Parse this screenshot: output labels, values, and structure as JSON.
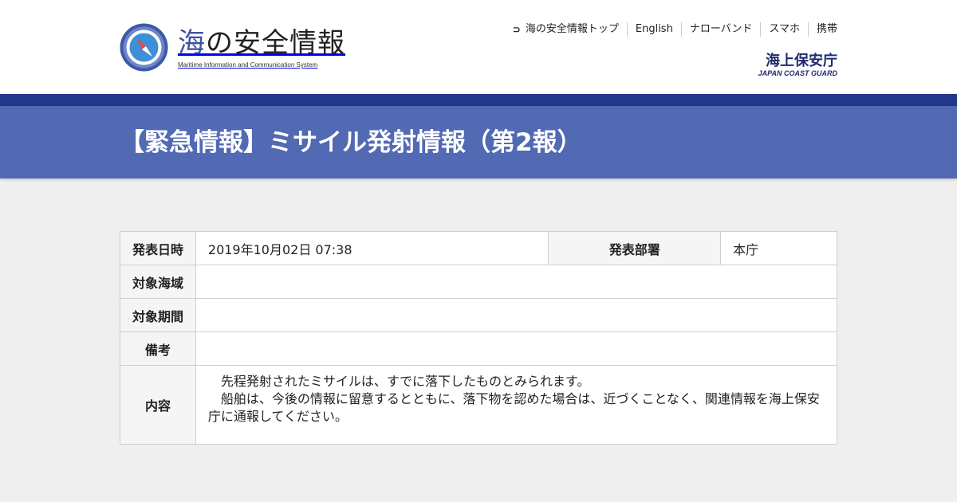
{
  "site": {
    "title_accent": "海",
    "title_rest": "の安全情報",
    "subtitle": "Maritime Information and Communication System",
    "logo_icon": "compass-icon"
  },
  "topnav": {
    "items": [
      {
        "label": "海の安全情報トップ",
        "icon": "return-arrow-icon"
      },
      {
        "label": "English"
      },
      {
        "label": "ナローバンド"
      },
      {
        "label": "スマホ"
      },
      {
        "label": "携帯"
      }
    ]
  },
  "agency": {
    "name_jp": "海上保安庁",
    "name_en": "JAPAN COAST GUARD"
  },
  "page": {
    "title": "【緊急情報】ミサイル発射情報（第2報）"
  },
  "info": {
    "issued_label": "発表日時",
    "issued_value": "2019年10月02日 07:38",
    "dept_label": "発表部署",
    "dept_value": "本庁",
    "area_label": "対象海域",
    "area_value": "",
    "period_label": "対象期間",
    "period_value": "",
    "remarks_label": "備考",
    "remarks_value": "",
    "content_label": "内容",
    "content_line1": "　先程発射されたミサイルは、すでに落下したものとみられます。",
    "content_line2": "　船舶は、今後の情報に留意するとともに、落下物を認めた場合は、近づくことなく、関連情報を海上保安庁に通報してください。"
  },
  "colors": {
    "title_band": "#5269b4",
    "dark_band": "#22378c",
    "brand_navy": "#1d2b6f",
    "background": "#efefef"
  }
}
